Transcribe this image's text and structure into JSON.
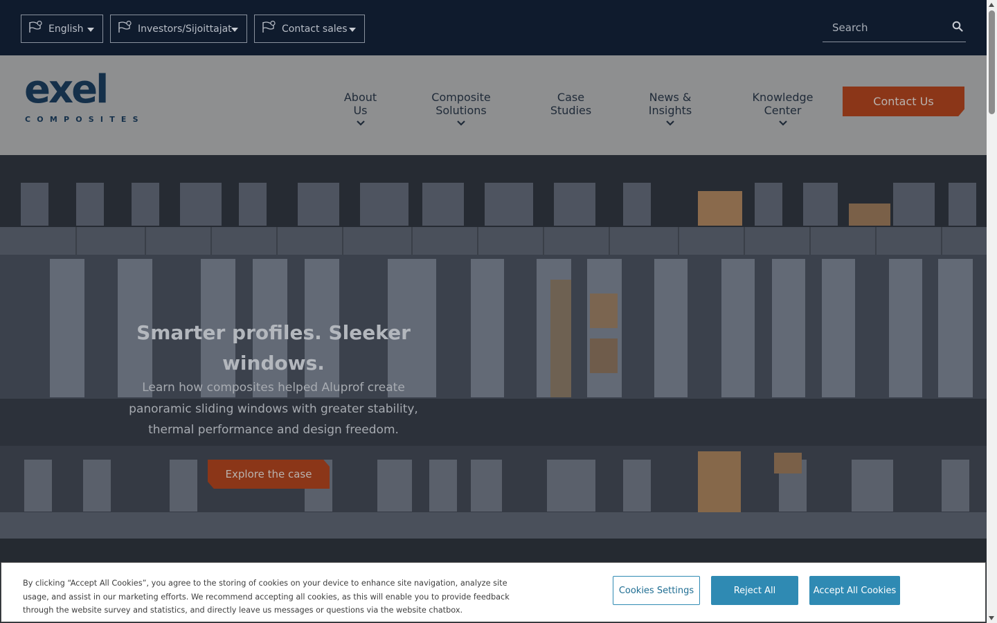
{
  "topbar": {
    "language": "English",
    "investors": "Investors/Sijoittajat",
    "contact_sales": "Contact sales",
    "search_placeholder": "Search"
  },
  "header": {
    "logo_text": "exel",
    "logo_sub": "COMPOSITES",
    "nav": [
      {
        "label": "About Us"
      },
      {
        "label": "Composite Solutions"
      },
      {
        "label": "Case Studies"
      },
      {
        "label": "News & Insights"
      },
      {
        "label": "Knowledge Center"
      }
    ],
    "contact_button": "Contact Us"
  },
  "hero": {
    "title": "Smarter profiles. Sleeker windows.",
    "text": "Learn how composites helped Aluprof create panoramic sliding windows with greater stability, thermal performance and design freedom.",
    "cta": "Explore the case"
  },
  "cookie_banner": {
    "text": "By clicking “Accept All Cookies”, you agree to the storing of cookies on your device to enhance site navigation, analyze site usage, and assist in our marketing efforts. We recommend accepting all cookies, as this will enable you to provide feedback through the website survey and statistics, and directly leave us messages or questions via the website chatbox.",
    "settings": "Cookies Settings",
    "reject": "Reject All",
    "accept": "Accept All Cookies"
  },
  "colors": {
    "topbar_bg": "#0f1b2d",
    "accent_orange": "#c9542a",
    "cookie_button": "#2f8ab3",
    "logo_navy": "#15304a"
  },
  "icons": [
    "flag-icon",
    "caret-down-icon",
    "search-icon",
    "chevron-down-icon"
  ]
}
